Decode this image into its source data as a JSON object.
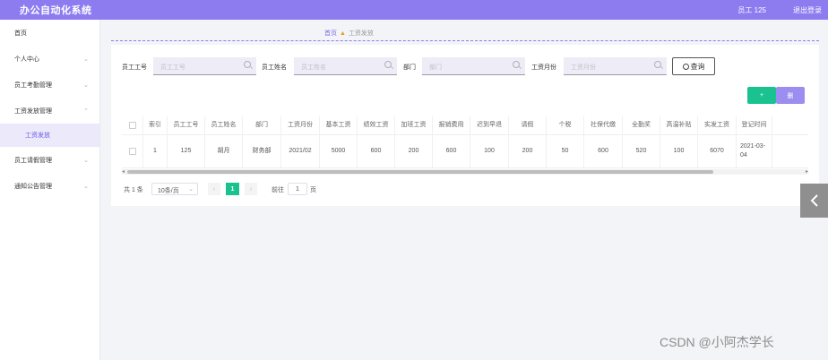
{
  "header": {
    "app_title": "办公自动化系统",
    "user": "员工 125",
    "logout": "退出登录"
  },
  "sidebar": {
    "items": [
      {
        "label": "首页"
      },
      {
        "label": "个人中心"
      },
      {
        "label": "员工考勤管理"
      },
      {
        "label": "工资发放管理"
      },
      {
        "label": "员工请假管理"
      },
      {
        "label": "通知公告管理"
      }
    ],
    "sub_item": "工资发放"
  },
  "breadcrumb": {
    "home": "首页",
    "current": "工资发放"
  },
  "search": {
    "emp_no_label": "员工工号",
    "emp_no_placeholder": "员工工号",
    "emp_name_label": "员工姓名",
    "emp_name_placeholder": "员工姓名",
    "dept_label": "部门",
    "dept_placeholder": "部门",
    "month_label": "工资月份",
    "month_placeholder": "工资月份",
    "query_button": "查询"
  },
  "actions": {
    "add": "+",
    "delete": "删"
  },
  "table": {
    "headers": [
      "",
      "索引",
      "员工工号",
      "员工姓名",
      "部门",
      "工资月份",
      "基本工资",
      "绩效工资",
      "加班工资",
      "报销费用",
      "迟到早退",
      "请假",
      "个税",
      "社保代缴",
      "全勤奖",
      "高温补贴",
      "实发工资",
      "登记时间"
    ],
    "rows": [
      [
        "",
        "1",
        "125",
        "胡月",
        "财务部",
        "2021/02",
        "5000",
        "600",
        "200",
        "600",
        "100",
        "200",
        "50",
        "600",
        "520",
        "100",
        "6070",
        "2021-03-04"
      ]
    ]
  },
  "scroll": {
    "left_arrow": "◂",
    "right_arrow": "▸"
  },
  "pagination": {
    "total": "共 1 条",
    "page_size": "10条/页",
    "current_page": "1",
    "goto_label": "前往",
    "goto_value": "1",
    "page_suffix": "页"
  },
  "watermark": "CSDN @小阿杰学长"
}
